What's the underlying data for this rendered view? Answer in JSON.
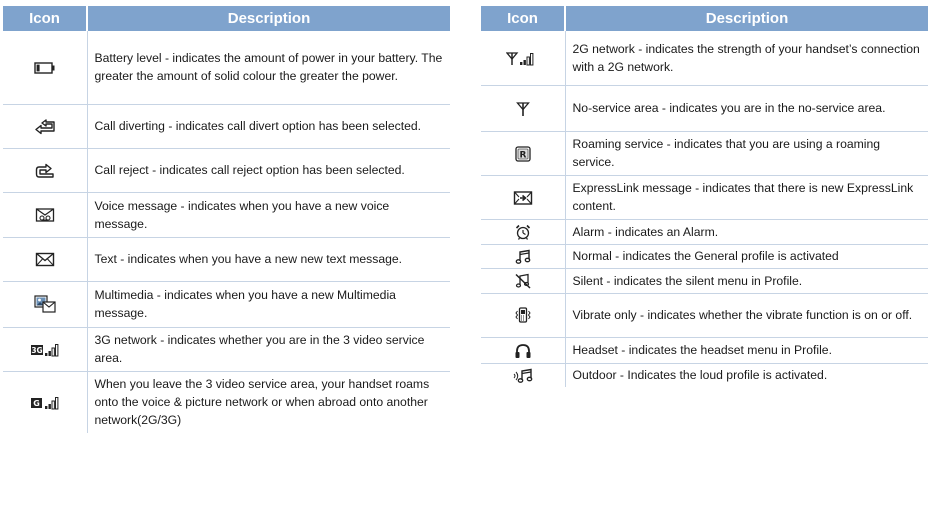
{
  "left_table": {
    "header_icon": "Icon",
    "header_description": "Description",
    "rows": [
      {
        "icon": "battery-icon",
        "description": "Battery level - indicates the amount of power in your battery. The greater the amount of solid colour the greater the power."
      },
      {
        "icon": "call-divert-icon",
        "description": "Call diverting - indicates call divert option has been selected."
      },
      {
        "icon": "call-reject-icon",
        "description": "Call reject - indicates call reject option has been selected."
      },
      {
        "icon": "voice-message-icon",
        "description": "Voice message - indicates when you have a new voice message."
      },
      {
        "icon": "envelope-icon",
        "description": "Text - indicates when you have a new new text message."
      },
      {
        "icon": "multimedia-message-icon",
        "description": "Multimedia - indicates when you have a new Multimedia message."
      },
      {
        "icon": "3g-signal-icon",
        "description": "3G network - indicates whether you are in the 3 video service area."
      },
      {
        "icon": "g-signal-icon",
        "description": "When you leave the 3 video service area, your handset roams onto the voice & picture network or when abroad onto another network(2G/3G)"
      }
    ]
  },
  "right_table": {
    "header_icon": "Icon",
    "header_description": "Description",
    "rows": [
      {
        "icon": "2g-signal-icon",
        "description": "2G network - indicates the strength of your handset’s connection with a 2G network."
      },
      {
        "icon": "antenna-icon",
        "description": "No-service area - indicates you are in the no-service area."
      },
      {
        "icon": "roaming-icon",
        "description": "Roaming service - indicates that you are using a roaming service."
      },
      {
        "icon": "expresslink-icon",
        "description": "ExpressLink message - indicates that there is new ExpressLink content."
      },
      {
        "icon": "alarm-clock-icon",
        "description": "Alarm - indicates an Alarm."
      },
      {
        "icon": "music-note-icon",
        "description": "Normal - indicates the General profile is activated"
      },
      {
        "icon": "silent-icon",
        "description": "Silent - indicates the silent menu in Profile."
      },
      {
        "icon": "vibrate-icon",
        "description": "Vibrate only - indicates whether the vibrate function is on or off."
      },
      {
        "icon": "headset-icon",
        "description": "Headset - indicates the headset menu in Profile."
      },
      {
        "icon": "outdoor-loud-icon",
        "description": "Outdoor - Indicates the loud profile is activated."
      }
    ]
  },
  "colors": {
    "header_bg": "#7fa3cd",
    "header_text": "#ffffff",
    "grid_line": "#c7d4e4"
  }
}
